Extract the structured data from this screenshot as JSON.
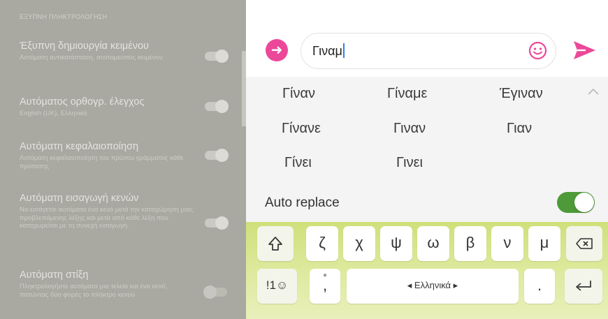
{
  "settings": {
    "section_title": "ΕΞΥΠΝΗ ΠΛΗΚΤΡΟΛΟΓΗΣΗ",
    "items": [
      {
        "title": "Έξυπνη δημιουργία κειμένου",
        "description": "Αυτόματη αντικατάσταση, συντομεύσεις κειμένου",
        "enabled": true
      },
      {
        "title": "Αυτόματος ορθογρ. έλεγχος",
        "description": "English (UK), Ελληνικά",
        "enabled": true
      },
      {
        "title": "Αυτόματη κεφαλαιοποίηση",
        "description": "Αυτόματη κεφαλαιοποίηση του πρώτου γράμματος κάθε πρότασης",
        "enabled": true
      },
      {
        "title": "Αυτόματη εισαγωγή κενών",
        "description": "Να εισάγεται αυτόματα ένα κενό μετά την καταχώρηση μιας προβλεπόμενης λέξης και μετά από κάθε λέξη που καταχωρείται με τη συνεχή εισαγωγή.",
        "enabled": true
      },
      {
        "title": "Αυτόματη στίξη",
        "description": "Πληκτρολογήστε αυτόματα μια τελεία και ένα κενό, πατώντας δύο φορές το πλήκτρο κενού",
        "enabled": false
      }
    ]
  },
  "input": {
    "text": "Γιναμ",
    "icons": {
      "expand": "arrow-right-icon",
      "emoji": "emoji-icon",
      "send": "send-icon"
    }
  },
  "suggestions": {
    "words": [
      "Γίναν",
      "Γίναμε",
      "Έγιναν",
      "Γίνανε",
      "Γιναν",
      "Γιαν",
      "Γίνει",
      "Γινει"
    ],
    "collapse_icon": "chevron-up-icon"
  },
  "auto_replace": {
    "label": "Auto replace",
    "enabled": true
  },
  "keyboard": {
    "row1": [
      "ζ",
      "χ",
      "ψ",
      "ω",
      "β",
      "ν",
      "μ"
    ],
    "shift_icon": "shift-icon",
    "backspace_icon": "backspace-icon",
    "symbols_label": "!1☺",
    "comma": ",",
    "space_label": "◂ Ελληνικά ▸",
    "period": ".",
    "enter_icon": "enter-icon"
  },
  "colors": {
    "accent_pink": "#ec4899",
    "toggle_green": "#4e9a38",
    "keyboard_bg": "#d6e58a"
  }
}
